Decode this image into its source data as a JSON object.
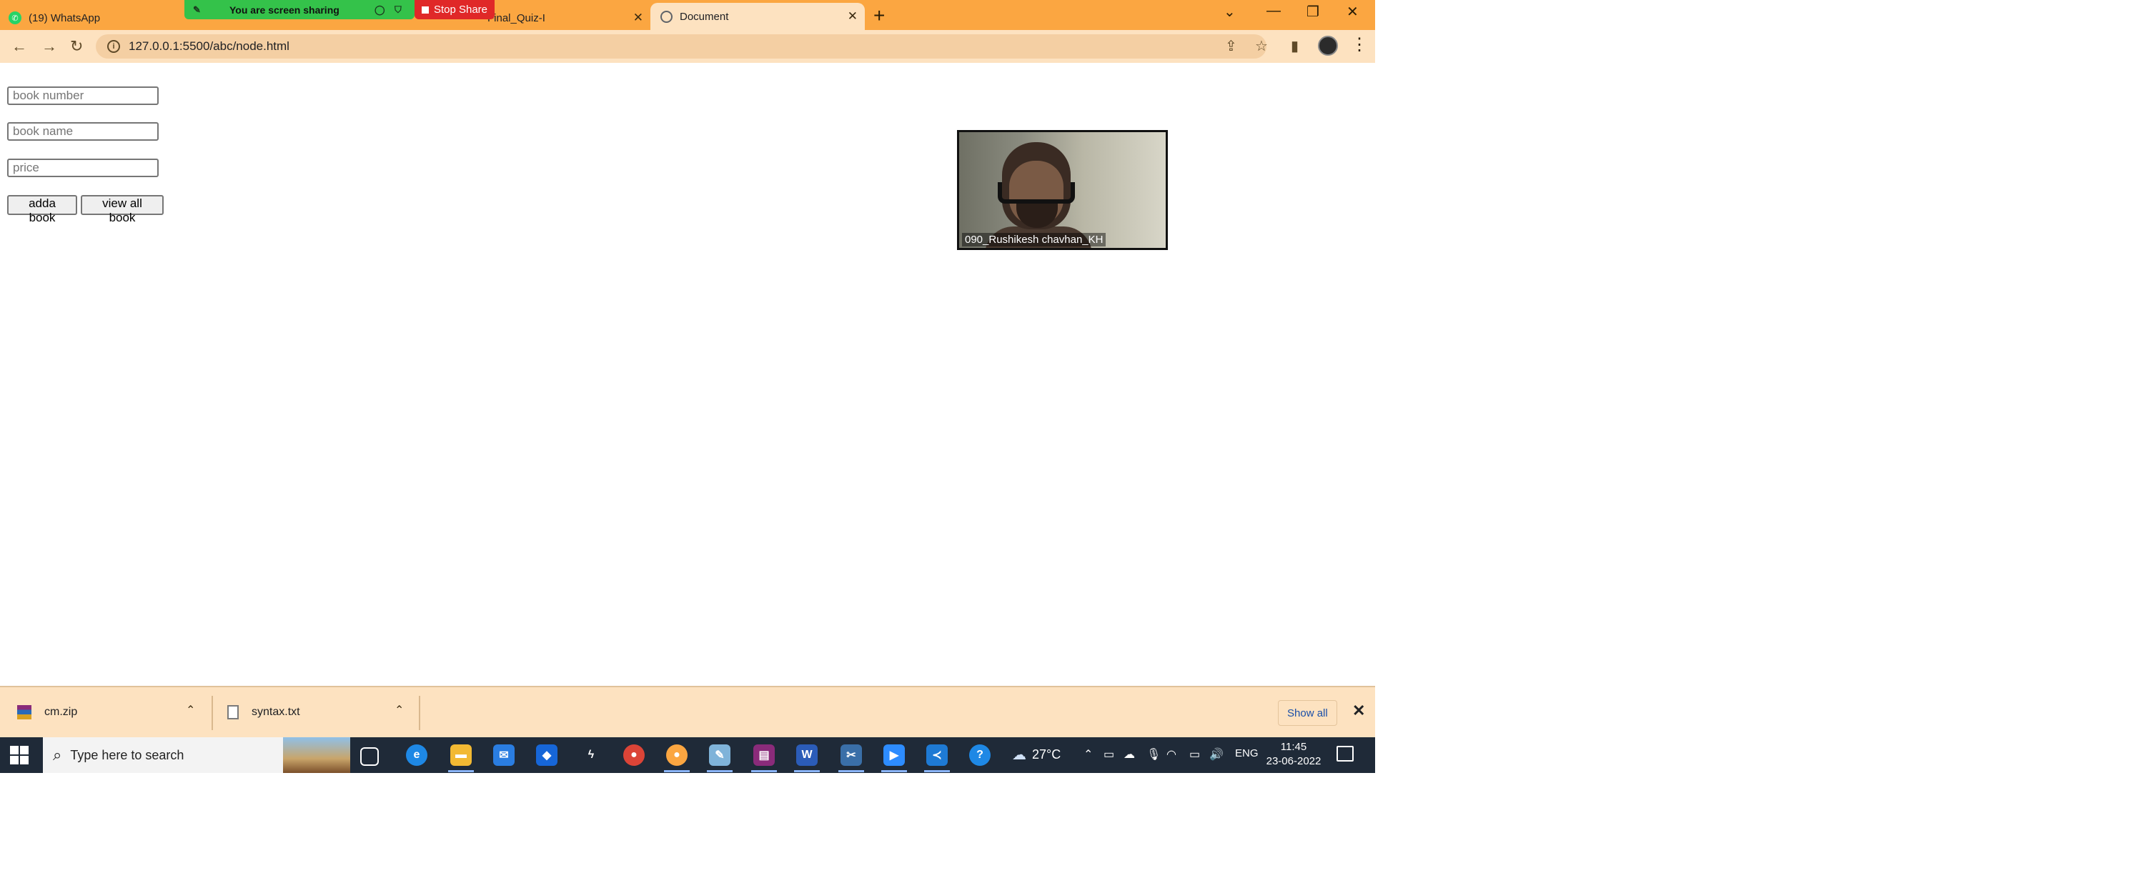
{
  "browser": {
    "tabs": [
      {
        "label": "(19) WhatsApp",
        "icon": "whatsapp-icon"
      },
      {
        "label": "Final_Quiz-I",
        "icon": "quiz-icon"
      },
      {
        "label": "Document",
        "icon": "globe-icon"
      }
    ],
    "active_tab": "Document",
    "url": "127.0.0.1:5500/abc/node.html"
  },
  "screen_share": {
    "banner_text": "You are screen sharing",
    "stop_label": "Stop Share",
    "banner_color": "#34c24a",
    "stop_color": "#e02828"
  },
  "form": {
    "book_number_placeholder": "book number",
    "book_name_placeholder": "book name",
    "price_placeholder": "price",
    "add_button": "adda book",
    "view_button": "view all book"
  },
  "video": {
    "participant_name": "090_Rushikesh chavhan_KH"
  },
  "downloads": {
    "items": [
      {
        "name": "cm.zip",
        "icon": "zip-icon"
      },
      {
        "name": "syntax.txt",
        "icon": "text-file-icon"
      }
    ],
    "show_all": "Show all"
  },
  "taskbar": {
    "search_placeholder": "Type here to search",
    "temperature": "27°C",
    "language": "ENG",
    "time": "11:45",
    "date": "23-06-2022",
    "background": "#1f2a38"
  },
  "theme": {
    "tabbar_color": "#fba641",
    "toolbar_color": "#fde2c0"
  }
}
